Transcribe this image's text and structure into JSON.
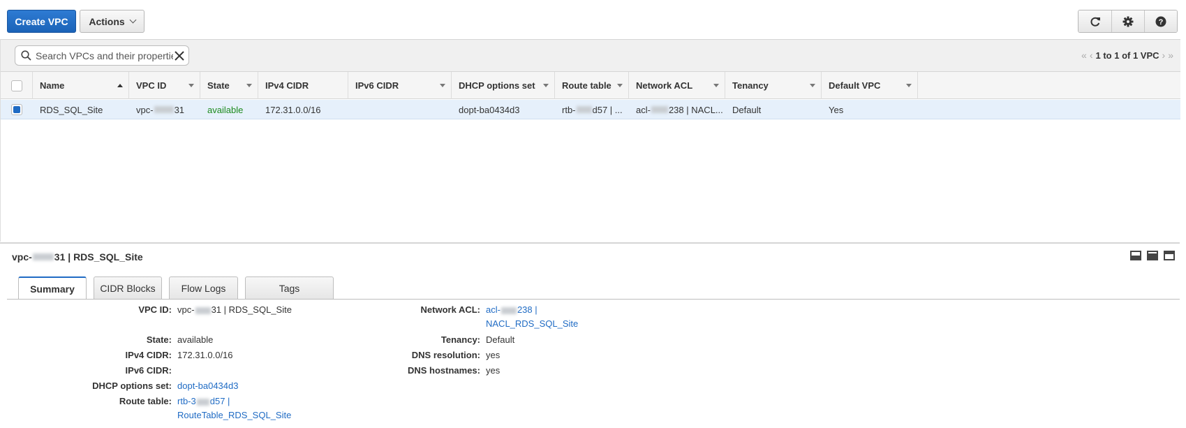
{
  "toolbar": {
    "create_label": "Create VPC",
    "actions_label": "Actions",
    "tools": [
      "refresh-icon",
      "gear-icon",
      "help-icon"
    ]
  },
  "search": {
    "placeholder": "Search VPCs and their properties",
    "pager_text": "1 to 1 of 1 VPC"
  },
  "table": {
    "columns": [
      "Name",
      "VPC ID",
      "State",
      "IPv4 CIDR",
      "IPv6 CIDR",
      "DHCP options set",
      "Route table",
      "Network ACL",
      "Tenancy",
      "Default VPC"
    ],
    "rows": [
      {
        "name": "RDS_SQL_Site",
        "vpc_id_prefix": "vpc-",
        "vpc_id_suffix": "31",
        "state": "available",
        "ipv4": "172.31.0.0/16",
        "ipv6": "",
        "dhcp": "dopt-ba0434d3",
        "route_prefix": "rtb-",
        "route_suffix": "d57 | ...",
        "acl_prefix": "acl-",
        "acl_suffix": "238 | NACL...",
        "tenancy": "Default",
        "default_vpc": "Yes"
      }
    ]
  },
  "detail": {
    "title_prefix": "vpc-",
    "title_suffix": "31 | RDS_SQL_Site",
    "tabs": [
      "Summary",
      "CIDR Blocks",
      "Flow Logs",
      "Tags"
    ],
    "left": {
      "vpc_id_label": "VPC ID:",
      "vpc_id_prefix": "vpc-",
      "vpc_id_suffix": "31 | RDS_SQL_Site",
      "state_label": "State:",
      "state": "available",
      "ipv4_label": "IPv4 CIDR:",
      "ipv4": "172.31.0.0/16",
      "ipv6_label": "IPv6 CIDR:",
      "ipv6": "",
      "dhcp_label": "DHCP options set:",
      "dhcp": "dopt-ba0434d3",
      "route_label": "Route table:",
      "route_prefix": "rtb-3",
      "route_suffix": "d57 |",
      "route_line2": "RouteTable_RDS_SQL_Site"
    },
    "right": {
      "acl_label": "Network ACL:",
      "acl_prefix": "acl-",
      "acl_suffix": "238 |",
      "acl_line2": "NACL_RDS_SQL_Site",
      "tenancy_label": "Tenancy:",
      "tenancy": "Default",
      "dns_res_label": "DNS resolution:",
      "dns_res": "yes",
      "dns_host_label": "DNS hostnames:",
      "dns_host": "yes"
    }
  },
  "colors": {
    "primary": "#1f6bc4",
    "selected_row": "#e6f0fb",
    "available_green": "#1d8a1d"
  }
}
